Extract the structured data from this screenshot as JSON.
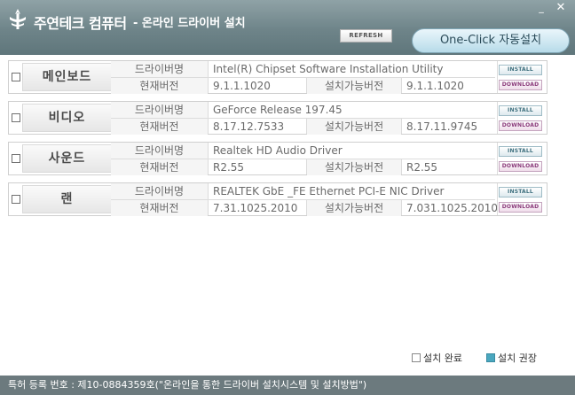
{
  "header": {
    "brand": "주연테크 컴퓨터",
    "subtitle": "- 온라인 드라이버 설치",
    "minimize": "_",
    "close": "✕"
  },
  "toolbar": {
    "refresh_label": "REFRESH",
    "oneclick_label": "One-Click 자동설치"
  },
  "drivers": [
    {
      "device": "메인보드",
      "name_label": "드라이버명",
      "name": "Intel(R) Chipset Software Installation Utility",
      "current_label": "현재버전",
      "current": "9.1.1.1020",
      "available_label": "설치가능버전",
      "available": "9.1.1.1020",
      "install_label": "INSTALL",
      "download_label": "DOWNLOAD"
    },
    {
      "device": "비디오",
      "name_label": "드라이버명",
      "name": "GeForce Release 197.45",
      "current_label": "현재버전",
      "current": "8.17.12.7533",
      "available_label": "설치가능버전",
      "available": "8.17.11.9745",
      "install_label": "INSTALL",
      "download_label": "DOWNLOAD"
    },
    {
      "device": "사운드",
      "name_label": "드라이버명",
      "name": "Realtek HD Audio Driver",
      "current_label": "현재버전",
      "current": "R2.55",
      "available_label": "설치가능버전",
      "available": "R2.55",
      "install_label": "INSTALL",
      "download_label": "DOWNLOAD"
    },
    {
      "device": "랜",
      "name_label": "드라이버명",
      "name": "REALTEK GbE _FE Ethernet PCI-E NIC Driver",
      "current_label": "현재버전",
      "current": "7.31.1025.2010",
      "available_label": "설치가능버전",
      "available": "7.031.1025.2010",
      "install_label": "INSTALL",
      "download_label": "DOWNLOAD"
    }
  ],
  "legend": {
    "done_label": "설치 완료",
    "recommended_label": "설치 권장",
    "done_color": "#ffffff",
    "recommended_color": "#4aa7bf"
  },
  "footer": {
    "patent_text": "특허 등록 번호 : 제10-0884359호(\"온라인을 통한 드라이버 설치시스템 및 설치방법\")"
  }
}
